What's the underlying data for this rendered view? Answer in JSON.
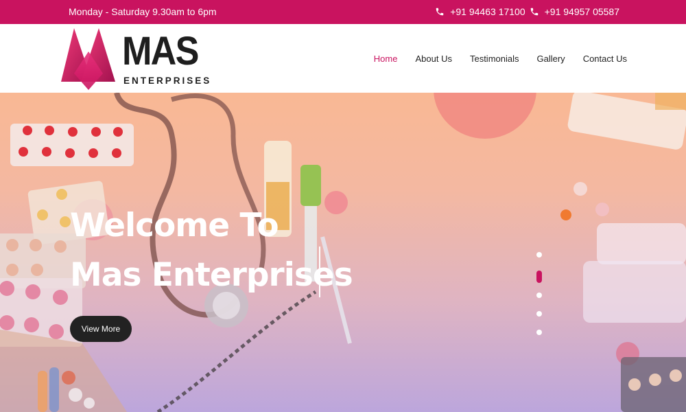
{
  "topbar": {
    "hours": "Monday - Saturday 9.30am to 6pm",
    "phones": [
      "+91 94463 17100",
      "+91 94957 05587"
    ],
    "phone_icon": "phone-icon",
    "bg_color": "#c9135f"
  },
  "header": {
    "logo_text": "MAS",
    "logo_subtext": "ENTERPRISES",
    "nav": [
      {
        "label": "Home",
        "active": true
      },
      {
        "label": "About Us",
        "active": false
      },
      {
        "label": "Testimonials",
        "active": false
      },
      {
        "label": "Gallery",
        "active": false
      },
      {
        "label": "Contact Us",
        "active": false
      }
    ],
    "accent_color": "#c9135f"
  },
  "hero": {
    "title_line1": "Welcome To",
    "title_line2": "Mas Enterprises",
    "button_label": "View More",
    "slide_count": 5,
    "active_slide": 2
  }
}
